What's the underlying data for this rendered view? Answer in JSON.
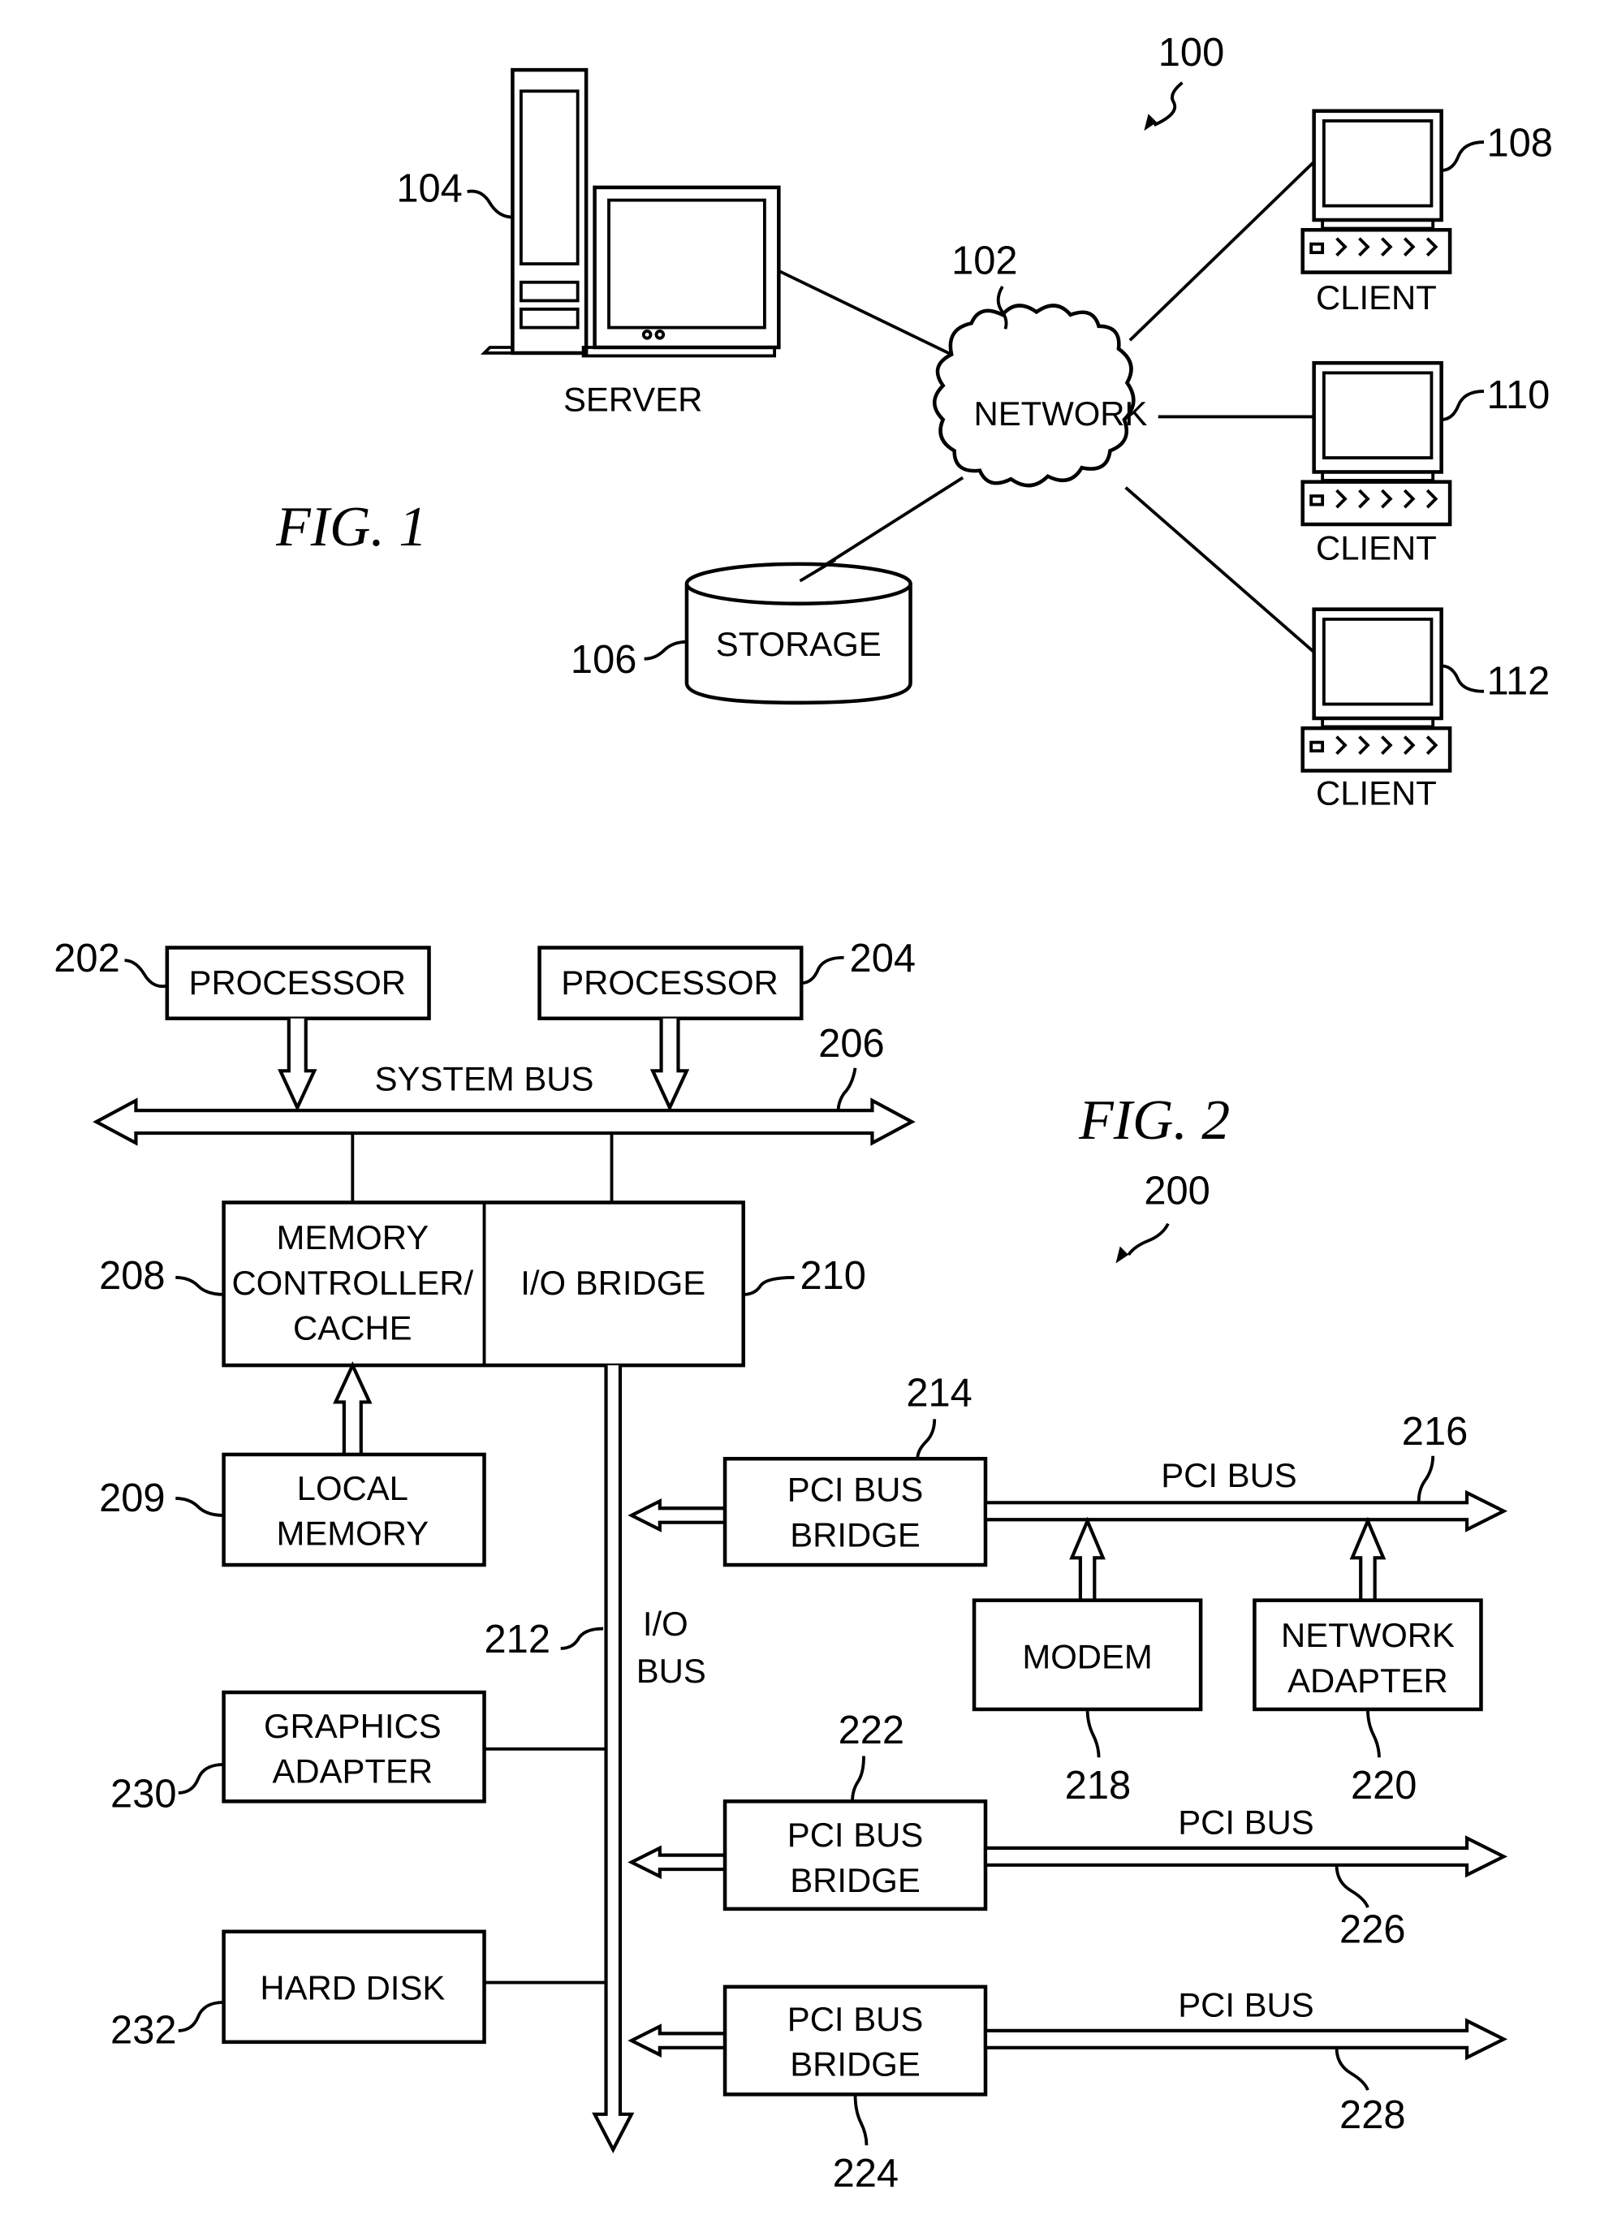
{
  "fig1": {
    "title": "FIG. 1",
    "ref": "100",
    "network": {
      "label": "NETWORK",
      "ref": "102"
    },
    "server": {
      "label": "SERVER",
      "ref": "104"
    },
    "storage": {
      "label": "STORAGE",
      "ref": "106"
    },
    "clients": [
      {
        "label": "CLIENT",
        "ref": "108"
      },
      {
        "label": "CLIENT",
        "ref": "110"
      },
      {
        "label": "CLIENT",
        "ref": "112"
      }
    ]
  },
  "fig2": {
    "title": "FIG. 2",
    "ref": "200",
    "processor1": {
      "label": "PROCESSOR",
      "ref": "202"
    },
    "processor2": {
      "label": "PROCESSOR",
      "ref": "204"
    },
    "system_bus": {
      "label": "SYSTEM BUS",
      "ref": "206"
    },
    "memory_controller": {
      "lines": [
        "MEMORY",
        "CONTROLLER/",
        "CACHE"
      ],
      "ref": "208"
    },
    "local_memory": {
      "lines": [
        "LOCAL",
        "MEMORY"
      ],
      "ref": "209"
    },
    "io_bridge": {
      "label": "I/O BRIDGE",
      "ref": "210"
    },
    "io_bus": {
      "lines": [
        "I/O",
        "BUS"
      ],
      "ref": "212"
    },
    "pci_bridge1": {
      "lines": [
        "PCI BUS",
        "BRIDGE"
      ],
      "ref": "214"
    },
    "pci_bus1": {
      "label": "PCI BUS",
      "ref": "216"
    },
    "modem": {
      "label": "MODEM",
      "ref": "218"
    },
    "network_adapter": {
      "lines": [
        "NETWORK",
        "ADAPTER"
      ],
      "ref": "220"
    },
    "pci_bridge2": {
      "lines": [
        "PCI BUS",
        "BRIDGE"
      ],
      "ref": "222"
    },
    "pci_bridge3": {
      "lines": [
        "PCI BUS",
        "BRIDGE"
      ],
      "ref": "224"
    },
    "pci_bus2": {
      "label": "PCI BUS",
      "ref": "226"
    },
    "pci_bus3": {
      "label": "PCI BUS",
      "ref": "228"
    },
    "graphics_adapter": {
      "lines": [
        "GRAPHICS",
        "ADAPTER"
      ],
      "ref": "230"
    },
    "hard_disk": {
      "label": "HARD DISK",
      "ref": "232"
    }
  }
}
